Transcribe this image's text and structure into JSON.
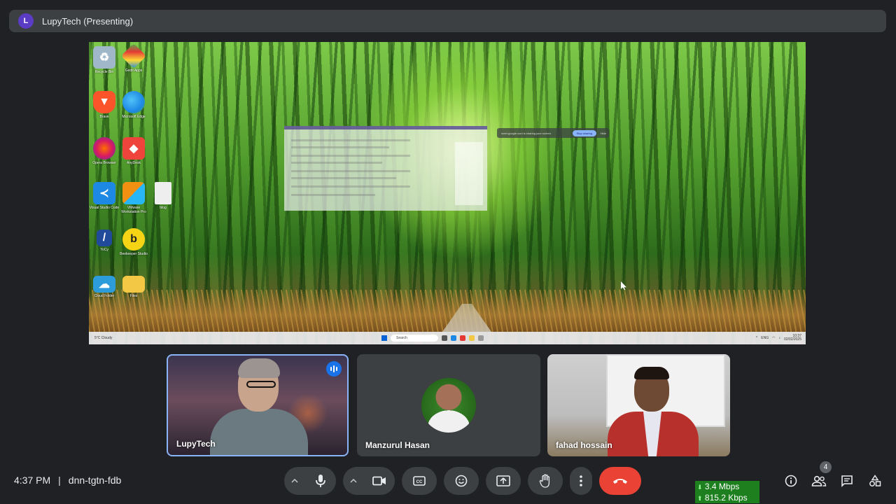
{
  "presenter_bar": {
    "avatar_letter": "L",
    "title": "LupyTech (Presenting)"
  },
  "shared_screen": {
    "desktop_icons": [
      {
        "label": "Recycle Bin",
        "icon": "recycle-bin-icon",
        "color": "#9fb7c9"
      },
      {
        "label": "Gedit Apps",
        "icon": "app-grid-icon",
        "color": "#4caf50"
      },
      {
        "label": "Brave",
        "icon": "brave-icon",
        "color": "#fb542b"
      },
      {
        "label": "Microsoft Edge",
        "icon": "edge-icon",
        "color": "#1e88e5"
      },
      {
        "label": "Opera Browser",
        "icon": "opera-icon",
        "color": "#7b3fa0"
      },
      {
        "label": "AnyDesk",
        "icon": "anydesk-icon",
        "color": "#ef443b"
      },
      {
        "label": "Visual Studio Code",
        "icon": "vscode-icon",
        "color": "#1e88e5"
      },
      {
        "label": "VMware Workstation Pro",
        "icon": "vmware-icon",
        "color": "#f29111"
      },
      {
        "label": "blog",
        "icon": "file-icon",
        "color": "#eeeeee"
      },
      {
        "label": "YoCy",
        "icon": "yocy-icon",
        "color": "#224a9a"
      },
      {
        "label": "Beekeeper Studio",
        "icon": "beekeeper-icon",
        "color": "#f5d416"
      },
      {
        "label": "Cloud Folder",
        "icon": "cloud-folder-icon",
        "color": "#2d9cdb"
      },
      {
        "label": "Files",
        "icon": "folder-icon",
        "color": "#f3c845"
      }
    ],
    "share_notice": "meet.google.com is sharing your screen",
    "stop_sharing": "Stop sharing",
    "hide": "Hide",
    "taskbar": {
      "weather": "5°C Cloudy",
      "search_placeholder": "Search",
      "lang": "ENG",
      "time": "10:37",
      "date": "02/02/2025"
    }
  },
  "participants": [
    {
      "name": "LupyTech",
      "speaking": true
    },
    {
      "name": "Manzurul Hasan",
      "speaking": false
    },
    {
      "name": "fahad hossain",
      "speaking": false
    }
  ],
  "footer": {
    "time": "4:37 PM",
    "separator": "|",
    "meeting_code": "dnn-tgtn-fdb",
    "download_speed": "3.4 Mbps",
    "upload_speed": "815.2 Kbps",
    "people_count": "4"
  },
  "colors": {
    "background": "#202124",
    "control": "#3c4043",
    "end_call": "#ea4335",
    "speaking_accent": "#1a73e8",
    "netstat": "#1e7f1e"
  }
}
